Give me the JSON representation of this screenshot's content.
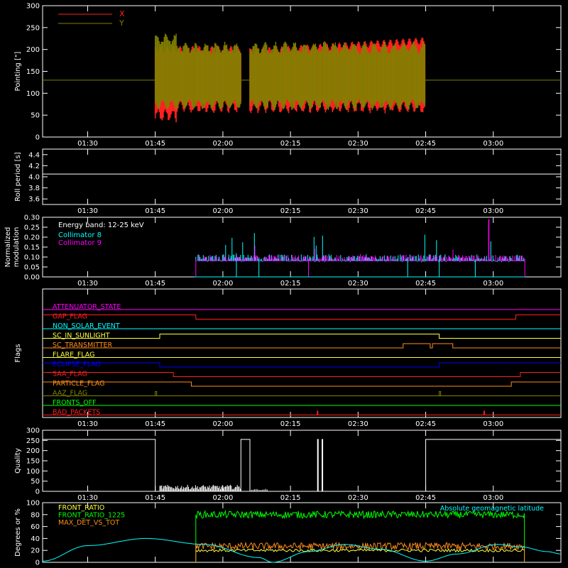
{
  "colors": {
    "background": "#000000",
    "axis": "#ffffff",
    "red": "#ff2020",
    "olive": "#808000",
    "cyan": "#00ffff",
    "magenta": "#ff00ff",
    "green": "#00ff00",
    "orange": "#ff8c1a",
    "yellow": "#ffff40",
    "blue": "#0000ff",
    "gold": "#e8a000"
  },
  "time_ticks": [
    "01:30",
    "01:45",
    "02:00",
    "02:15",
    "02:30",
    "02:45",
    "03:00"
  ],
  "chart_data": [
    {
      "type": "line",
      "ylabel": "Pointing [\"]",
      "ylim": [
        0,
        300
      ],
      "yticks": [
        "0",
        "50",
        "100",
        "150",
        "200",
        "250",
        "300"
      ],
      "legend": [
        {
          "name": "X",
          "color": "#ff2020"
        },
        {
          "name": "Y",
          "color": "#808000"
        }
      ],
      "segments": [
        [
          "01:45",
          "02:04"
        ],
        [
          "02:06",
          "02:45"
        ]
      ],
      "series": [
        {
          "name": "X",
          "envelope_low": 65,
          "envelope_high": 225,
          "early_low": 45
        },
        {
          "name": "Y",
          "envelope_low": 65,
          "envelope_high": 215,
          "early_high": 235
        }
      ],
      "reference_line": 130
    },
    {
      "type": "line",
      "ylabel": "Roll period [s]",
      "ylim": [
        3.5,
        4.5
      ],
      "yticks": [
        "3.6",
        "3.8",
        "4.0",
        "4.2",
        "4.4"
      ],
      "series": [
        {
          "name": "",
          "values_constant": 4.05
        }
      ]
    },
    {
      "type": "line",
      "ylabel_lines": [
        "Normalized",
        "modulation"
      ],
      "ylim": [
        0,
        0.3
      ],
      "yticks": [
        "0.00",
        "0.05",
        "0.10",
        "0.15",
        "0.20",
        "0.25",
        "0.30"
      ],
      "annotation": "Energy band: 12-25 keV",
      "legend": [
        {
          "name": "Collimator 8",
          "color": "#00ffff"
        },
        {
          "name": "Collimator 9",
          "color": "#ff00ff"
        }
      ],
      "segment": [
        "01:54",
        "03:07"
      ],
      "baseline": 0.09
    },
    {
      "type": "line",
      "ylabel": "Flags",
      "flags": [
        {
          "name": "ATTENUATOR_STATE",
          "color": "#ff00ff",
          "transitions": []
        },
        {
          "name": "GAP_FLAG",
          "color": "#ff2020",
          "transitions": [
            [
              "01:30",
              1
            ],
            [
              "01:54",
              0
            ],
            [
              "03:05",
              1
            ]
          ]
        },
        {
          "name": "NON_SOLAR_EVENT",
          "color": "#00ffff",
          "transitions": []
        },
        {
          "name": "SC_IN_SUNLIGHT",
          "color": "#ffff40",
          "transitions": [
            [
              "01:30",
              0
            ],
            [
              "01:46",
              1
            ],
            [
              "02:48",
              0
            ]
          ]
        },
        {
          "name": "SC_TRANSMITTER",
          "color": "#ff8c1a",
          "transitions": [
            [
              "01:30",
              0
            ],
            [
              "02:40",
              1
            ],
            [
              "02:46",
              0
            ],
            [
              "02:46.5",
              1
            ],
            [
              "02:51",
              0
            ]
          ]
        },
        {
          "name": "FLARE_FLAG",
          "color": "#ffff40",
          "transitions": []
        },
        {
          "name": "ECLIPSE_FLAG",
          "color": "#0000ff",
          "transitions": [
            [
              "01:30",
              1
            ],
            [
              "01:46",
              0
            ],
            [
              "02:48",
              1
            ]
          ]
        },
        {
          "name": "SAA_FLAG",
          "color": "#ff2020",
          "transitions": [
            [
              "01:30",
              1
            ],
            [
              "01:49",
              0
            ],
            [
              "03:06",
              1
            ]
          ]
        },
        {
          "name": "PARTICLE_FLAG",
          "color": "#ff8c1a",
          "transitions": [
            [
              "01:30",
              1
            ],
            [
              "01:53",
              0
            ],
            [
              "03:04",
              1
            ]
          ]
        },
        {
          "name": "AAZ_FLAG",
          "color": "#808000",
          "transitions": []
        },
        {
          "name": "FRONTS_OFF",
          "color": "#00ff00",
          "transitions": []
        },
        {
          "name": "BAD_PACKETS",
          "color": "#ff2020",
          "transitions": []
        }
      ]
    },
    {
      "type": "line",
      "ylabel": "Quality",
      "ylim": [
        0,
        300
      ],
      "yticks": [
        "0",
        "50",
        "100",
        "150",
        "200",
        "250",
        "300"
      ],
      "series": [
        {
          "name": "",
          "values": "255 before 01:45, low noise 01:46–02:05, 255 at 02:04–02:06, spikes at 02:21, 255 after 02:45"
        }
      ]
    },
    {
      "type": "line",
      "ylabel": "Degrees or %",
      "ylim": [
        0,
        100
      ],
      "yticks": [
        "0",
        "20",
        "40",
        "60",
        "80",
        "100"
      ],
      "legend": [
        {
          "name": "FRONT_RATIO",
          "color": "#ffff40"
        },
        {
          "name": "FRONT_RATIO_1225",
          "color": "#00ff00"
        },
        {
          "name": "MAX_DET_VS_TOT",
          "color": "#ff8c1a"
        }
      ],
      "annotation": "Absolute geomagnetic latitude",
      "series": [
        {
          "name": "FRONT_RATIO",
          "level": 20
        },
        {
          "name": "FRONT_RATIO_1225",
          "level": 80
        },
        {
          "name": "MAX_DET_VS_TOT",
          "level": 27
        },
        {
          "name": "Absolute geomagnetic latitude",
          "peak": 40
        }
      ]
    }
  ]
}
